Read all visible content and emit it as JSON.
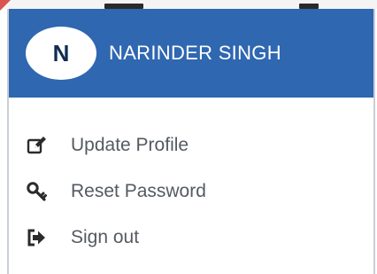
{
  "profile": {
    "avatar_initial": "N",
    "name": "NARINDER SINGH"
  },
  "menu": {
    "items": [
      {
        "label": "Update Profile",
        "icon": "edit-icon"
      },
      {
        "label": "Reset Password",
        "icon": "key-icon"
      },
      {
        "label": "Sign out",
        "icon": "sign-out-icon"
      }
    ]
  },
  "colors": {
    "header_bg": "#2f67b1",
    "avatar_bg": "#ffffff",
    "avatar_text": "#0f2d52",
    "menu_text": "#555a60",
    "icon_color": "#2b2b2b"
  }
}
